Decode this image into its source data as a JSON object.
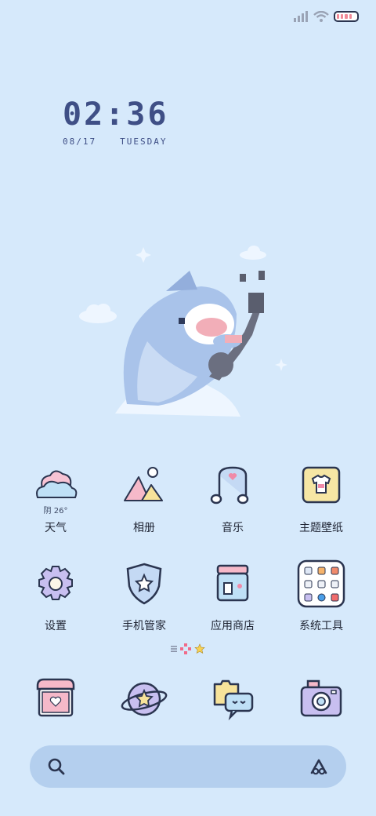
{
  "status": {
    "signal_icon": "signal-icon",
    "wifi_icon": "wifi-icon",
    "battery_icon": "battery-icon",
    "battery_level": 0.8
  },
  "clock": {
    "time": "02:36",
    "date": "08/17",
    "weekday": "TUESDAY"
  },
  "apps": [
    {
      "label": "天气",
      "sub": "阴 26°",
      "icon": "weather-cloud-icon"
    },
    {
      "label": "相册",
      "sub": "",
      "icon": "gallery-mountain-icon"
    },
    {
      "label": "音乐",
      "sub": "",
      "icon": "music-note-icon"
    },
    {
      "label": "主题壁纸",
      "sub": "",
      "icon": "theme-shirt-icon"
    },
    {
      "label": "设置",
      "sub": "",
      "icon": "settings-gear-icon"
    },
    {
      "label": "手机管家",
      "sub": "",
      "icon": "security-shield-icon"
    },
    {
      "label": "应用商店",
      "sub": "",
      "icon": "app-store-icon"
    },
    {
      "label": "系统工具",
      "sub": "",
      "icon": "system-tools-folder-icon"
    }
  ],
  "dock": [
    {
      "icon": "phone-icon"
    },
    {
      "icon": "browser-planet-icon"
    },
    {
      "icon": "messages-chat-icon"
    },
    {
      "icon": "camera-icon"
    }
  ],
  "search": {
    "search_icon": "search-icon",
    "assistant_icon": "assistant-a-icon"
  },
  "colors": {
    "background": "#d6e9fb",
    "clock": "#3f4f86",
    "search_bar": "#b4cfee"
  }
}
